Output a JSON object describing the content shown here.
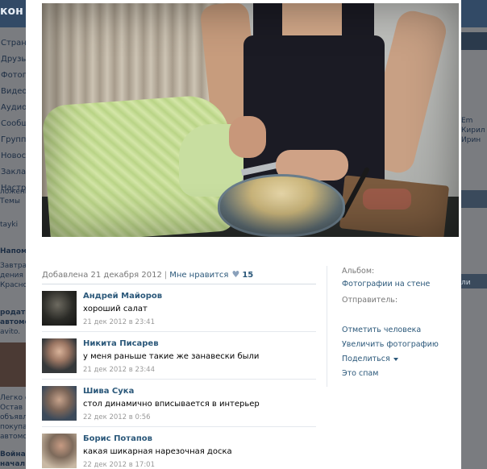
{
  "background": {
    "logo": "кон",
    "nav": [
      "Страни",
      "Друзья",
      "Фотогр",
      "Видео",
      "Аудио",
      "Сообщ",
      "Группы",
      "Новост",
      "Заклад",
      "Настро"
    ],
    "block1": [
      "ложени",
      "Темы"
    ],
    "block1b": "tayki",
    "block2": [
      "Напоми",
      "Завтра",
      "дения К",
      "Красно"
    ],
    "block3": [
      "родать",
      "автомо",
      "avito."
    ],
    "block4": [
      "Легко с А",
      "Остав",
      "объявле",
      "покупа",
      "автомо"
    ],
    "block5": [
      "Война",
      "начал"
    ],
    "right": [
      "Em",
      "Кирил",
      "Ирин",
      "ли"
    ]
  },
  "meta": {
    "added": "Добавлена 21 декабря 2012",
    "separator": "|",
    "like_label": "Мне нравится",
    "like_icon": "heart-icon",
    "likes": "15"
  },
  "comments": [
    {
      "author": "Андрей Майоров",
      "text": "хороший салат",
      "date": "21 дек 2012 в 23:41"
    },
    {
      "author": "Никита Писарев",
      "text": "у меня раньше такие же занавески были",
      "date": "21 дек 2012 в 23:44"
    },
    {
      "author": "Шива Сука",
      "text": "стол динамично вписывается в интерьер",
      "date": "22 дек 2012 в 0:56"
    },
    {
      "author": "Борис Потапов",
      "text": "какая шикарная нарезочная доска",
      "date": "22 дек 2012 в 17:01"
    }
  ],
  "side": {
    "album_label": "Альбом:",
    "album_link": "Фотографии на стене",
    "sender_label": "Отправитель:",
    "actions": [
      "Отметить человека",
      "Увеличить фотографию",
      "Поделиться",
      "Это спам"
    ]
  },
  "colors": {
    "link": "#2b587a",
    "muted": "#777777",
    "header": "#324a66"
  }
}
